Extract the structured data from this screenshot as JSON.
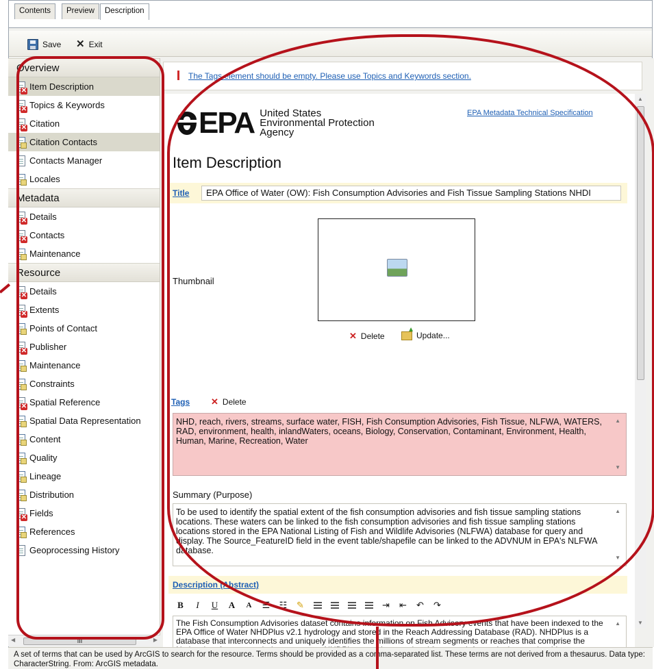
{
  "tabs": [
    {
      "label": "Contents"
    },
    {
      "label": "Preview"
    },
    {
      "label": "Description"
    }
  ],
  "toolbar": {
    "save_label": "Save",
    "exit_label": "Exit"
  },
  "nav": {
    "overview": {
      "header": "Overview",
      "items": [
        {
          "label": "Item Description",
          "icon": "error-doc-icon"
        },
        {
          "label": "Topics & Keywords",
          "icon": "error-doc-icon"
        },
        {
          "label": "Citation",
          "icon": "error-doc-icon"
        },
        {
          "label": "Citation Contacts",
          "icon": "edit-doc-icon"
        },
        {
          "label": "Contacts Manager",
          "icon": "doc-icon"
        },
        {
          "label": "Locales",
          "icon": "edit-doc-icon"
        }
      ]
    },
    "metadata": {
      "header": "Metadata",
      "items": [
        {
          "label": "Details",
          "icon": "error-doc-icon"
        },
        {
          "label": "Contacts",
          "icon": "error-doc-icon"
        },
        {
          "label": "Maintenance",
          "icon": "edit-doc-icon"
        }
      ]
    },
    "resource": {
      "header": "Resource",
      "items": [
        {
          "label": "Details",
          "icon": "error-doc-icon"
        },
        {
          "label": "Extents",
          "icon": "error-doc-icon"
        },
        {
          "label": "Points of Contact",
          "icon": "edit-doc-icon"
        },
        {
          "label": "Publisher",
          "icon": "error-doc-icon"
        },
        {
          "label": "Maintenance",
          "icon": "edit-doc-icon"
        },
        {
          "label": "Constraints",
          "icon": "edit-doc-icon"
        },
        {
          "label": "Spatial Reference",
          "icon": "error-doc-icon"
        },
        {
          "label": "Spatial Data Representation",
          "icon": "edit-doc-icon"
        },
        {
          "label": "Content",
          "icon": "edit-doc-icon"
        },
        {
          "label": "Quality",
          "icon": "edit-doc-icon"
        },
        {
          "label": "Lineage",
          "icon": "edit-doc-icon"
        },
        {
          "label": "Distribution",
          "icon": "edit-doc-icon"
        },
        {
          "label": "Fields",
          "icon": "error-doc-icon"
        },
        {
          "label": "References",
          "icon": "edit-doc-icon"
        },
        {
          "label": "Geoprocessing History",
          "icon": "doc-icon"
        }
      ]
    },
    "hscroll_label": "III"
  },
  "warning": {
    "text": "The Tags element should be empty. Please use Topics and Keywords section."
  },
  "epa": {
    "logo_text": "EPA",
    "line1": "United States",
    "line2": "Environmental Protection",
    "line3": "Agency",
    "spec_link": "EPA Metadata Technical Specification"
  },
  "page_title": "Item Description",
  "title_field": {
    "label": "Title",
    "value": "EPA Office of Water (OW): Fish Consumption Advisories and Fish Tissue Sampling Stations NHDI"
  },
  "thumbnail": {
    "label": "Thumbnail",
    "delete_label": "Delete",
    "update_label": "Update..."
  },
  "tags": {
    "label": "Tags",
    "delete_label": "Delete",
    "value": "NHD, reach, rivers, streams, surface water, FISH, Fish Consumption Advisories, Fish Tissue, NLFWA, WATERS, RAD, environment, health, inlandWaters, oceans, Biology, Conservation, Contaminant, Environment, Health, Human, Marine, Recreation, Water"
  },
  "summary": {
    "label": "Summary (Purpose)",
    "value": "To be used to identify the spatial extent of the fish consumption advisories and fish tissue sampling stations locations. These waters can be linked to the fish consumption advisories and fish tissue sampling stations locations stored in the EPA National Listing of Fish and Wildlife Advisories (NLFWA) database for query and display. The Source_FeatureID field in the event table/shapefile can be linked to the ADVNUM in EPA's NLFWA database."
  },
  "description": {
    "label": "Description (Abstract)",
    "toolbar": [
      "B",
      "I",
      "U",
      "A",
      "A"
    ],
    "value": "The Fish Consumption Advisories dataset contains information on Fish Advisory events that have been indexed to the EPA Office of Water NHDPlus v2.1 hydrology and stored in the Reach Addressing Database (RAD). NHDPlus is a database that interconnects and uniquely identifies the millions of stream segments or reaches that comprise the Nations' surface water drainage system. NHDPlus provides a national framework for assigning reach addresses to water quality related entities, such as fish advisories locations. Reach addresses establish"
  },
  "status_text": "A set of terms that can be used by ArcGIS to search for the resource. Terms should be provided as a comma-separated list. These terms are not derived from a thesaurus. Data type: CharacterString. From: ArcGIS metadata.",
  "colors": {
    "annotation": "#b5121b",
    "error": "#d02a2a",
    "link": "#1e5fb4",
    "tags_bg": "#f7c8c8"
  }
}
